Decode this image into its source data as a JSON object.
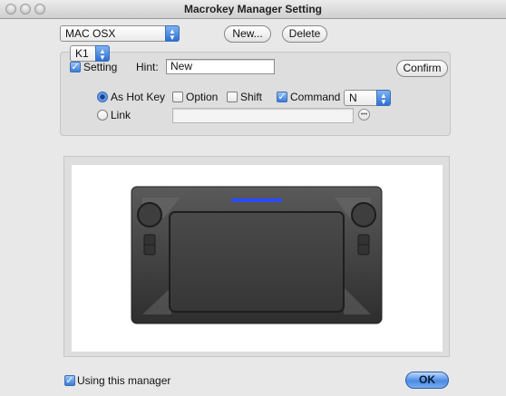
{
  "window": {
    "title": "Macrokey Manager Setting"
  },
  "top": {
    "profile_select": "MAC OSX",
    "new_label": "New...",
    "delete_label": "Delete"
  },
  "key": {
    "key_select": "K1",
    "setting_label": "Setting",
    "setting_checked": true,
    "hint_label": "Hint:",
    "hint_value": "New",
    "confirm_label": "Confirm"
  },
  "action": {
    "hotkey_label": "As Hot Key",
    "hotkey_selected": true,
    "option_label": "Option",
    "option_checked": false,
    "shift_label": "Shift",
    "shift_checked": false,
    "command_label": "Command",
    "command_checked": true,
    "key_select": "N",
    "link_label": "Link",
    "link_selected": false,
    "link_value": ""
  },
  "footer": {
    "using_label": "Using this manager",
    "using_checked": true,
    "ok_label": "OK"
  },
  "colors": {
    "accent": "#3a7bd8",
    "device_body": "#3a3a3a",
    "device_led": "#2a4cff"
  }
}
